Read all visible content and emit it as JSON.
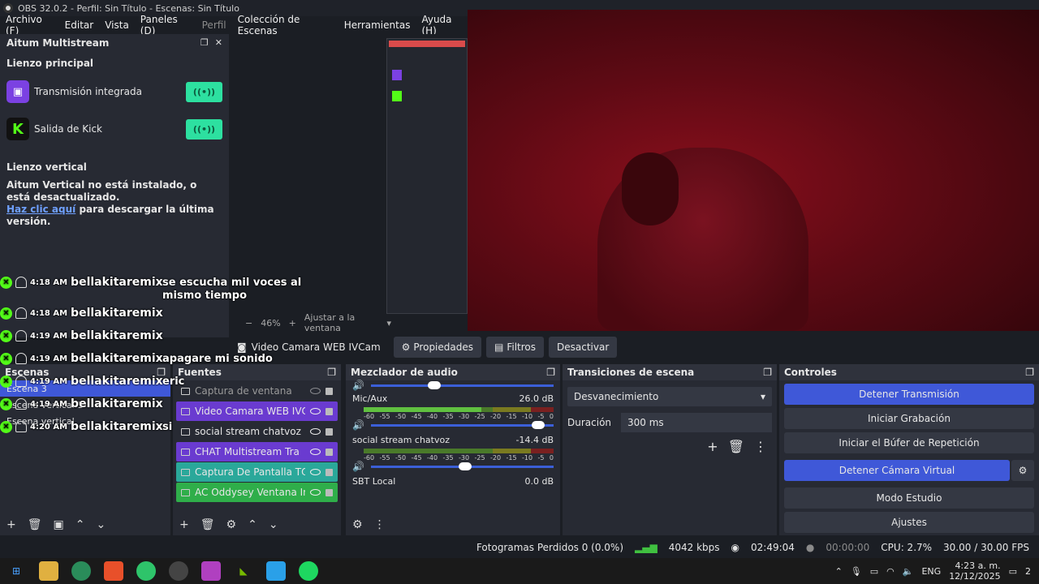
{
  "window": {
    "title": "OBS 32.0.2 - Perfil: Sin Título - Escenas: Sin Título"
  },
  "menu": [
    "Archivo (F)",
    "Editar",
    "Vista",
    "Paneles (D)",
    "Perfil",
    "Colección de Escenas",
    "Herramientas",
    "Ayuda (H)"
  ],
  "aitum": {
    "title": "Aitum Multistream",
    "main_canvas": "Lienzo principal",
    "outputs": [
      {
        "label": "Transmisión integrada",
        "icon": "twitch-icon"
      },
      {
        "label": "Salida de Kick",
        "icon": "kick-icon"
      }
    ],
    "vertical_title": "Lienzo vertical",
    "vertical_msg": "Aitum Vertical no está instalado, o está desactualizado.",
    "vertical_link": "Haz clic aquí",
    "vertical_tail": " para descargar la última versión."
  },
  "preview": {
    "zoom": "46%",
    "fit": "Ajustar a la ventana"
  },
  "source_toolbar": {
    "source_name": "Video Camara WEB IVCam",
    "properties": "Propiedades",
    "filters": "Filtros",
    "deactivate": "Desactivar"
  },
  "scenes": {
    "title": "Escenas",
    "items": [
      "Escena 3",
      "Escena vertical 1",
      "Escena vertical"
    ],
    "selected": 0
  },
  "sources": {
    "title": "Fuentes",
    "items": [
      {
        "name": "Captura de ventana",
        "style": "dim"
      },
      {
        "name": "Video Camara WEB IVCa",
        "style": "purple"
      },
      {
        "name": "social stream chatvoz",
        "style": ""
      },
      {
        "name": "CHAT Multistream Tra",
        "style": "purple"
      },
      {
        "name": "Captura De Pantalla TOD",
        "style": "teal"
      },
      {
        "name": "AC Oddysey Ventana Ind",
        "style": "green"
      }
    ]
  },
  "mixer": {
    "title": "Mezclador de audio",
    "channels": [
      {
        "name": "Mic/Aux",
        "db": "26.0 dB",
        "level": 0.62,
        "fader": 0.95
      },
      {
        "name": "social stream chatvoz",
        "db": "-14.4 dB",
        "level": 0.0,
        "fader": 0.55
      },
      {
        "name": "SBT Local",
        "db": "0.0 dB",
        "level": 0.0,
        "fader": 0.5
      }
    ],
    "scale": [
      "-60",
      "-55",
      "-50",
      "-45",
      "-40",
      "-35",
      "-30",
      "-25",
      "-20",
      "-15",
      "-10",
      "-5",
      "0"
    ]
  },
  "transitions": {
    "title": "Transiciones de escena",
    "selected": "Desvanecimiento",
    "duration_label": "Duración",
    "duration_value": "300 ms"
  },
  "controls": {
    "title": "Controles",
    "stop_stream": "Detener Transmisión",
    "start_record": "Iniciar Grabación",
    "replay_buffer": "Iniciar el Búfer de Repetición",
    "stop_vcam": "Detener Cámara Virtual",
    "studio_mode": "Modo Estudio",
    "settings": "Ajustes"
  },
  "status": {
    "dropped": "Fotogramas Perdidos 0 (0.0%)",
    "bitrate": "4042 kbps",
    "stream_time": "02:49:04",
    "rec_time": "00:00:00",
    "cpu": "CPU: 2.7%",
    "fps": "30.00 / 30.00 FPS"
  },
  "chat": [
    {
      "time": "4:18 AM",
      "user": "bellakitaremix",
      "msg": "se escucha mil voces al\nmismo tiempo"
    },
    {
      "time": "4:18 AM",
      "user": "bellakitaremix",
      "msg": ""
    },
    {
      "time": "4:19 AM",
      "user": "bellakitaremix",
      "msg": ""
    },
    {
      "time": "4:19 AM",
      "user": "bellakitaremix",
      "msg": "apagare mi sonido"
    },
    {
      "time": "4:19 AM",
      "user": "bellakitaremix",
      "msg": "eric"
    },
    {
      "time": "4:19 AM",
      "user": "bellakitaremix",
      "msg": ""
    },
    {
      "time": "4:20 AM",
      "user": "bellakitaremix",
      "msg": "si"
    }
  ],
  "taskbar": {
    "lang": "ENG",
    "time": "4:23 a. m.",
    "date": "12/12/2025",
    "notif": "2"
  }
}
